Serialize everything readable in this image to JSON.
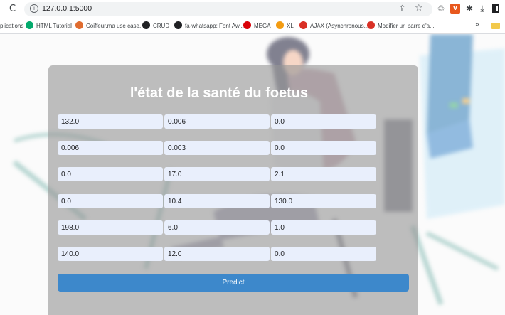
{
  "browser": {
    "url": "127.0.0.1:5000",
    "bookmarks": [
      {
        "label": "plications",
        "icon": "apps-icon",
        "color": "#4285f4"
      },
      {
        "label": "HTML Tutorial",
        "icon": "w3schools-icon",
        "color": "#04aa6d"
      },
      {
        "label": "Coiffeur.ma use case...",
        "icon": "coiffeur-icon",
        "color": "#e06c2f"
      },
      {
        "label": "CRUD",
        "icon": "github-icon",
        "color": "#202124"
      },
      {
        "label": "fa-whatsapp: Font Aw...",
        "icon": "fontawesome-icon",
        "color": "#202124"
      },
      {
        "label": "MEGA",
        "icon": "mega-icon",
        "color": "#d90007"
      },
      {
        "label": "XL",
        "icon": "xl-icon",
        "color": "#f39c12"
      },
      {
        "label": "AJAX (Asynchronous...",
        "icon": "question-icon",
        "color": "#d93025"
      },
      {
        "label": "Modifier url barre d'a...",
        "icon": "question-icon",
        "color": "#d93025"
      }
    ],
    "more_bookmarks": "»"
  },
  "form": {
    "title": "l'état de la santé du foetus",
    "fields": [
      [
        "132.0",
        "0.006",
        "0.0"
      ],
      [
        "0.006",
        "0.003",
        "0.0"
      ],
      [
        "0.0",
        "17.0",
        "2.1"
      ],
      [
        "0.0",
        "10.4",
        "130.0"
      ],
      [
        "198.0",
        "6.0",
        "1.0"
      ],
      [
        "140.0",
        "12.0",
        "0.0"
      ]
    ],
    "predict_label": "Predict"
  },
  "colors": {
    "button": "#3d88cb",
    "field_bg": "#e9effc",
    "card_overlay": "rgba(150,150,150,0.62)"
  }
}
